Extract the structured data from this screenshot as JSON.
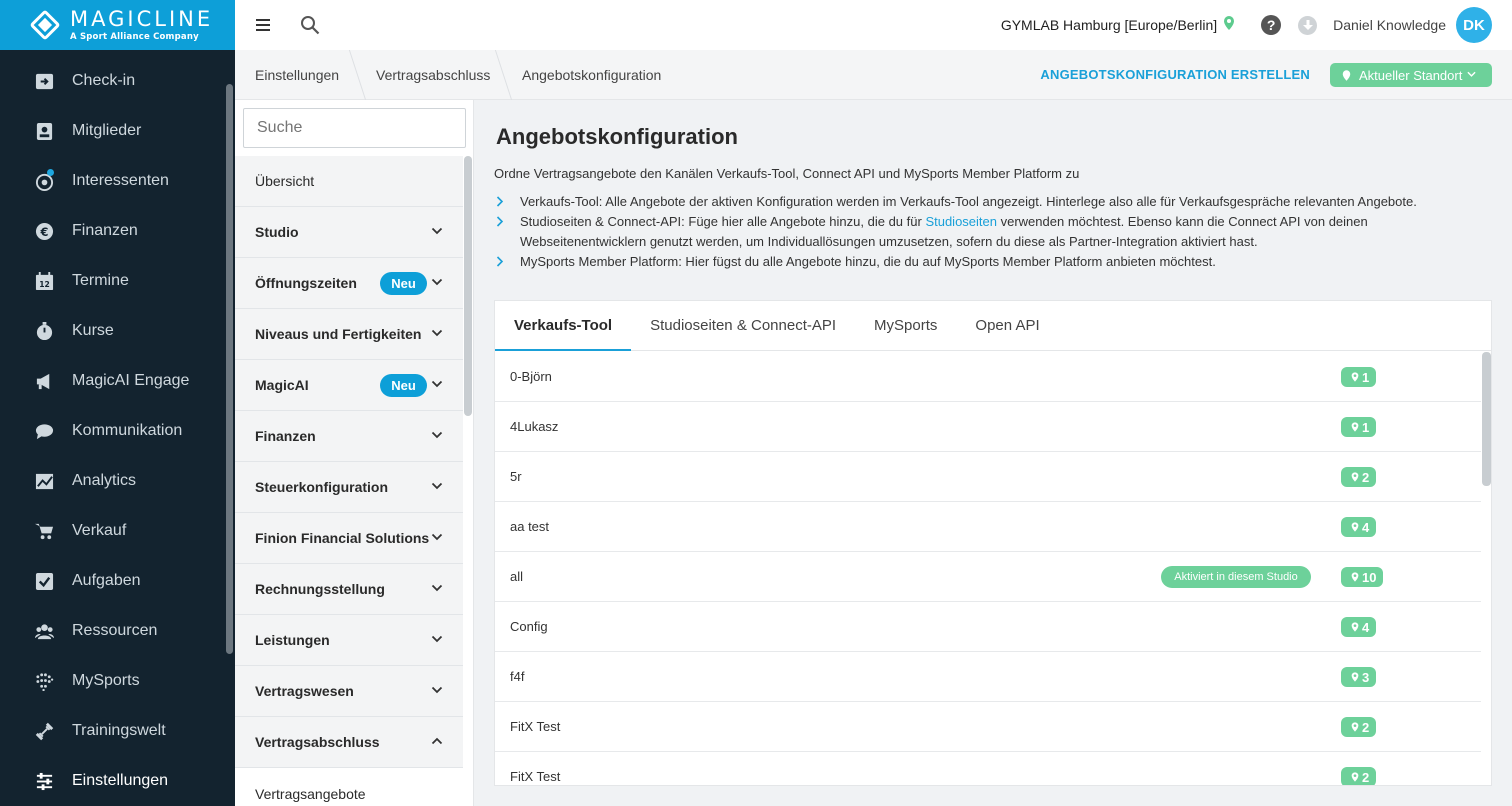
{
  "brand": {
    "title": "MAGICLINE",
    "subtitle": "A Sport Alliance Company"
  },
  "nav": [
    {
      "label": "Check-in",
      "icon": "checkin-icon"
    },
    {
      "label": "Mitglieder",
      "icon": "members-icon"
    },
    {
      "label": "Interessenten",
      "icon": "prospects-icon"
    },
    {
      "label": "Finanzen",
      "icon": "euro-icon"
    },
    {
      "label": "Termine",
      "icon": "calendar-icon"
    },
    {
      "label": "Kurse",
      "icon": "stopwatch-icon"
    },
    {
      "label": "MagicAI Engage",
      "icon": "megaphone-icon"
    },
    {
      "label": "Kommunikation",
      "icon": "chat-icon"
    },
    {
      "label": "Analytics",
      "icon": "chart-icon"
    },
    {
      "label": "Verkauf",
      "icon": "cart-icon"
    },
    {
      "label": "Aufgaben",
      "icon": "checkbox-icon"
    },
    {
      "label": "Ressourcen",
      "icon": "people-icon"
    },
    {
      "label": "MySports",
      "icon": "mysports-icon"
    },
    {
      "label": "Trainingswelt",
      "icon": "dumbbell-icon"
    },
    {
      "label": "Einstellungen",
      "icon": "sliders-icon"
    }
  ],
  "header": {
    "studio": "GYMLAB Hamburg [Europe/Berlin]",
    "user": "Daniel Knowledge",
    "initials": "DK"
  },
  "breadcrumb": [
    "Einstellungen",
    "Vertragsabschluss",
    "Angebotskonfiguration"
  ],
  "actions": {
    "create": "ANGEBOTSKONFIGURATION ERSTELLEN",
    "location": "Aktueller Standort"
  },
  "settings": {
    "search_placeholder": "Suche",
    "items": [
      {
        "label": "Übersicht",
        "type": "plain"
      },
      {
        "label": "Studio",
        "type": "group"
      },
      {
        "label": "Öffnungszeiten",
        "type": "group",
        "badge": "Neu"
      },
      {
        "label": "Niveaus und Fertigkeiten",
        "type": "group"
      },
      {
        "label": "MagicAI",
        "type": "group",
        "badge": "Neu"
      },
      {
        "label": "Finanzen",
        "type": "group"
      },
      {
        "label": "Steuerkonfiguration",
        "type": "group"
      },
      {
        "label": "Finion Financial Solutions",
        "type": "group"
      },
      {
        "label": "Rechnungsstellung",
        "type": "group"
      },
      {
        "label": "Leistungen",
        "type": "group"
      },
      {
        "label": "Vertragswesen",
        "type": "group"
      },
      {
        "label": "Vertragsabschluss",
        "type": "group",
        "expanded": true
      },
      {
        "label": "Vertragsangebote",
        "type": "child"
      }
    ]
  },
  "main": {
    "title": "Angebotskonfiguration",
    "description": "Ordne Vertragsangebote den Kanälen Verkaufs-Tool, Connect API und MySports Member Platform zu",
    "bullet1": "Verkaufs-Tool: Alle Angebote der aktiven Konfiguration werden im Verkaufs-Tool angezeigt. Hinterlege also alle für Verkaufsgespräche relevanten Angebote.",
    "bullet2_pre": "Studioseiten & Connect-API: Füge hier alle Angebote hinzu, die du für ",
    "bullet2_link": "Studioseiten",
    "bullet2_post": " verwenden möchtest. Ebenso kann die Connect API von deinen Webseitenentwicklern genutzt werden, um Individuallösungen umzusetzen, sofern du diese als Partner-Integration aktiviert hast.",
    "bullet3": "MySports Member Platform: Hier fügst du alle Angebote hinzu, die du auf MySports Member Platform anbieten möchtest.",
    "tabs": [
      "Verkaufs-Tool",
      "Studioseiten & Connect-API",
      "MySports",
      "Open API"
    ],
    "active_badge": "Aktiviert in diesem Studio",
    "rows": [
      {
        "name": "0-Björn",
        "count": "1"
      },
      {
        "name": "4Lukasz",
        "count": "1"
      },
      {
        "name": "5r",
        "count": "2"
      },
      {
        "name": "aa test",
        "count": "4"
      },
      {
        "name": "all",
        "count": "10",
        "active": true
      },
      {
        "name": "Config",
        "count": "4"
      },
      {
        "name": "f4f",
        "count": "3"
      },
      {
        "name": "FitX Test",
        "count": "2"
      },
      {
        "name": "FitX Test",
        "count": "2"
      }
    ]
  },
  "colors": {
    "brand": "#0d9fd8",
    "nav_bg": "#13232f",
    "green": "#6dd19a",
    "link": "#1aa0d8"
  }
}
